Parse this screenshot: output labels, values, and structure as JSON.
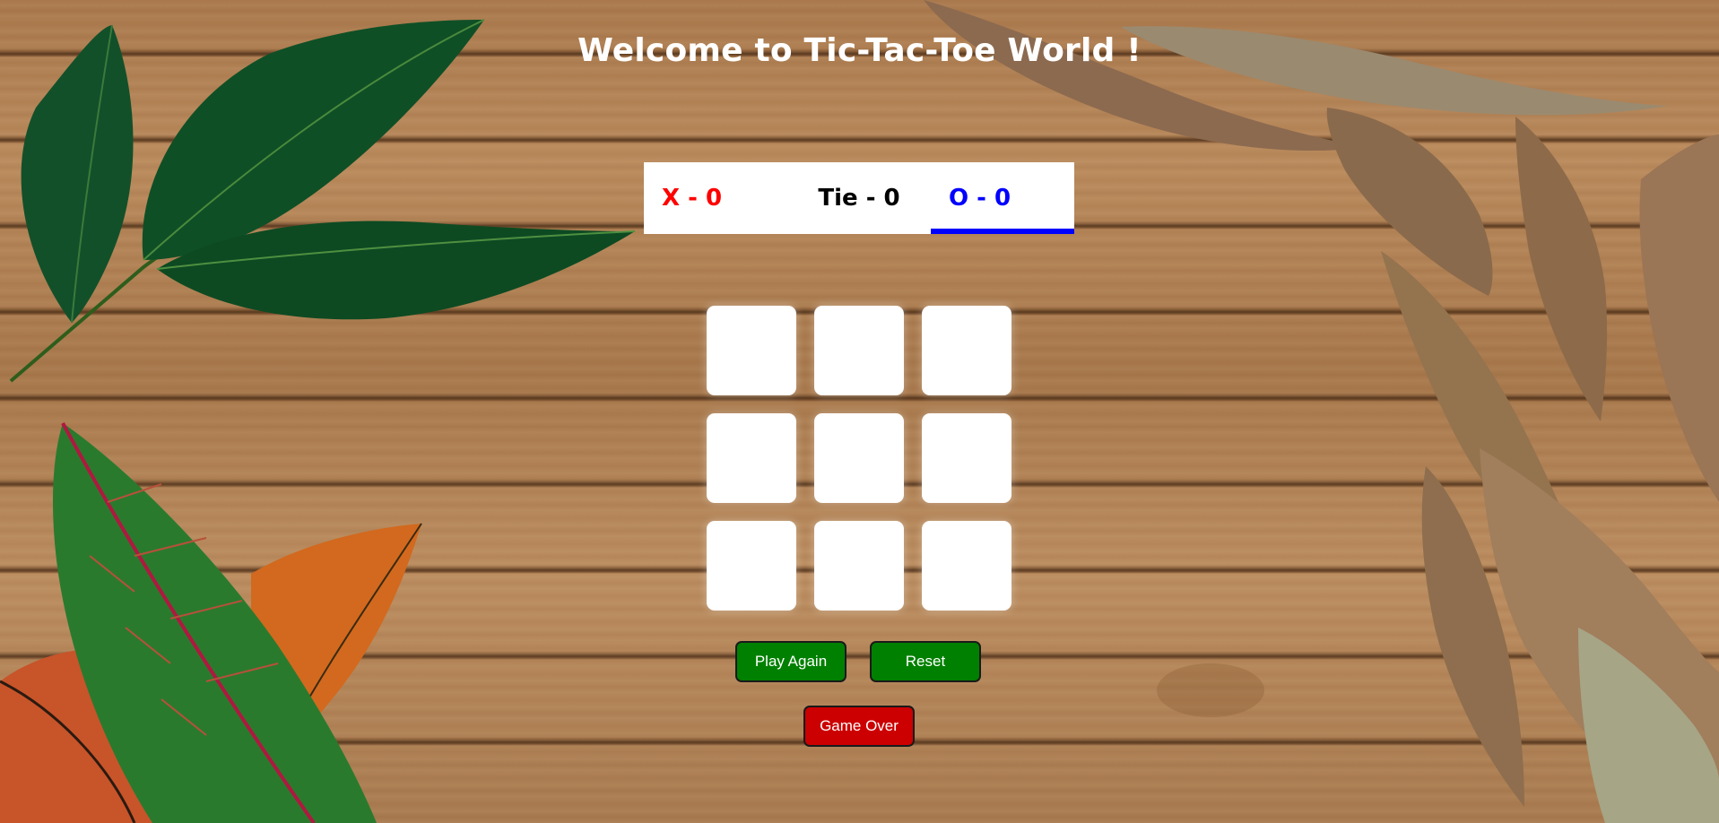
{
  "title": "Welcome to Tic-Tac-Toe World !",
  "scoreboard": {
    "x_label": "X - 0",
    "tie_label": "Tie - 0",
    "o_label": "O - 0",
    "active_player": "O"
  },
  "board": {
    "cells": [
      "",
      "",
      "",
      "",
      "",
      "",
      "",
      "",
      ""
    ]
  },
  "buttons": {
    "play_again": "Play Again",
    "reset": "Reset",
    "game_over": "Game Over"
  },
  "colors": {
    "x": "#ff0000",
    "o": "#0000ff",
    "button_green": "#008000",
    "button_red": "#cc0000"
  }
}
